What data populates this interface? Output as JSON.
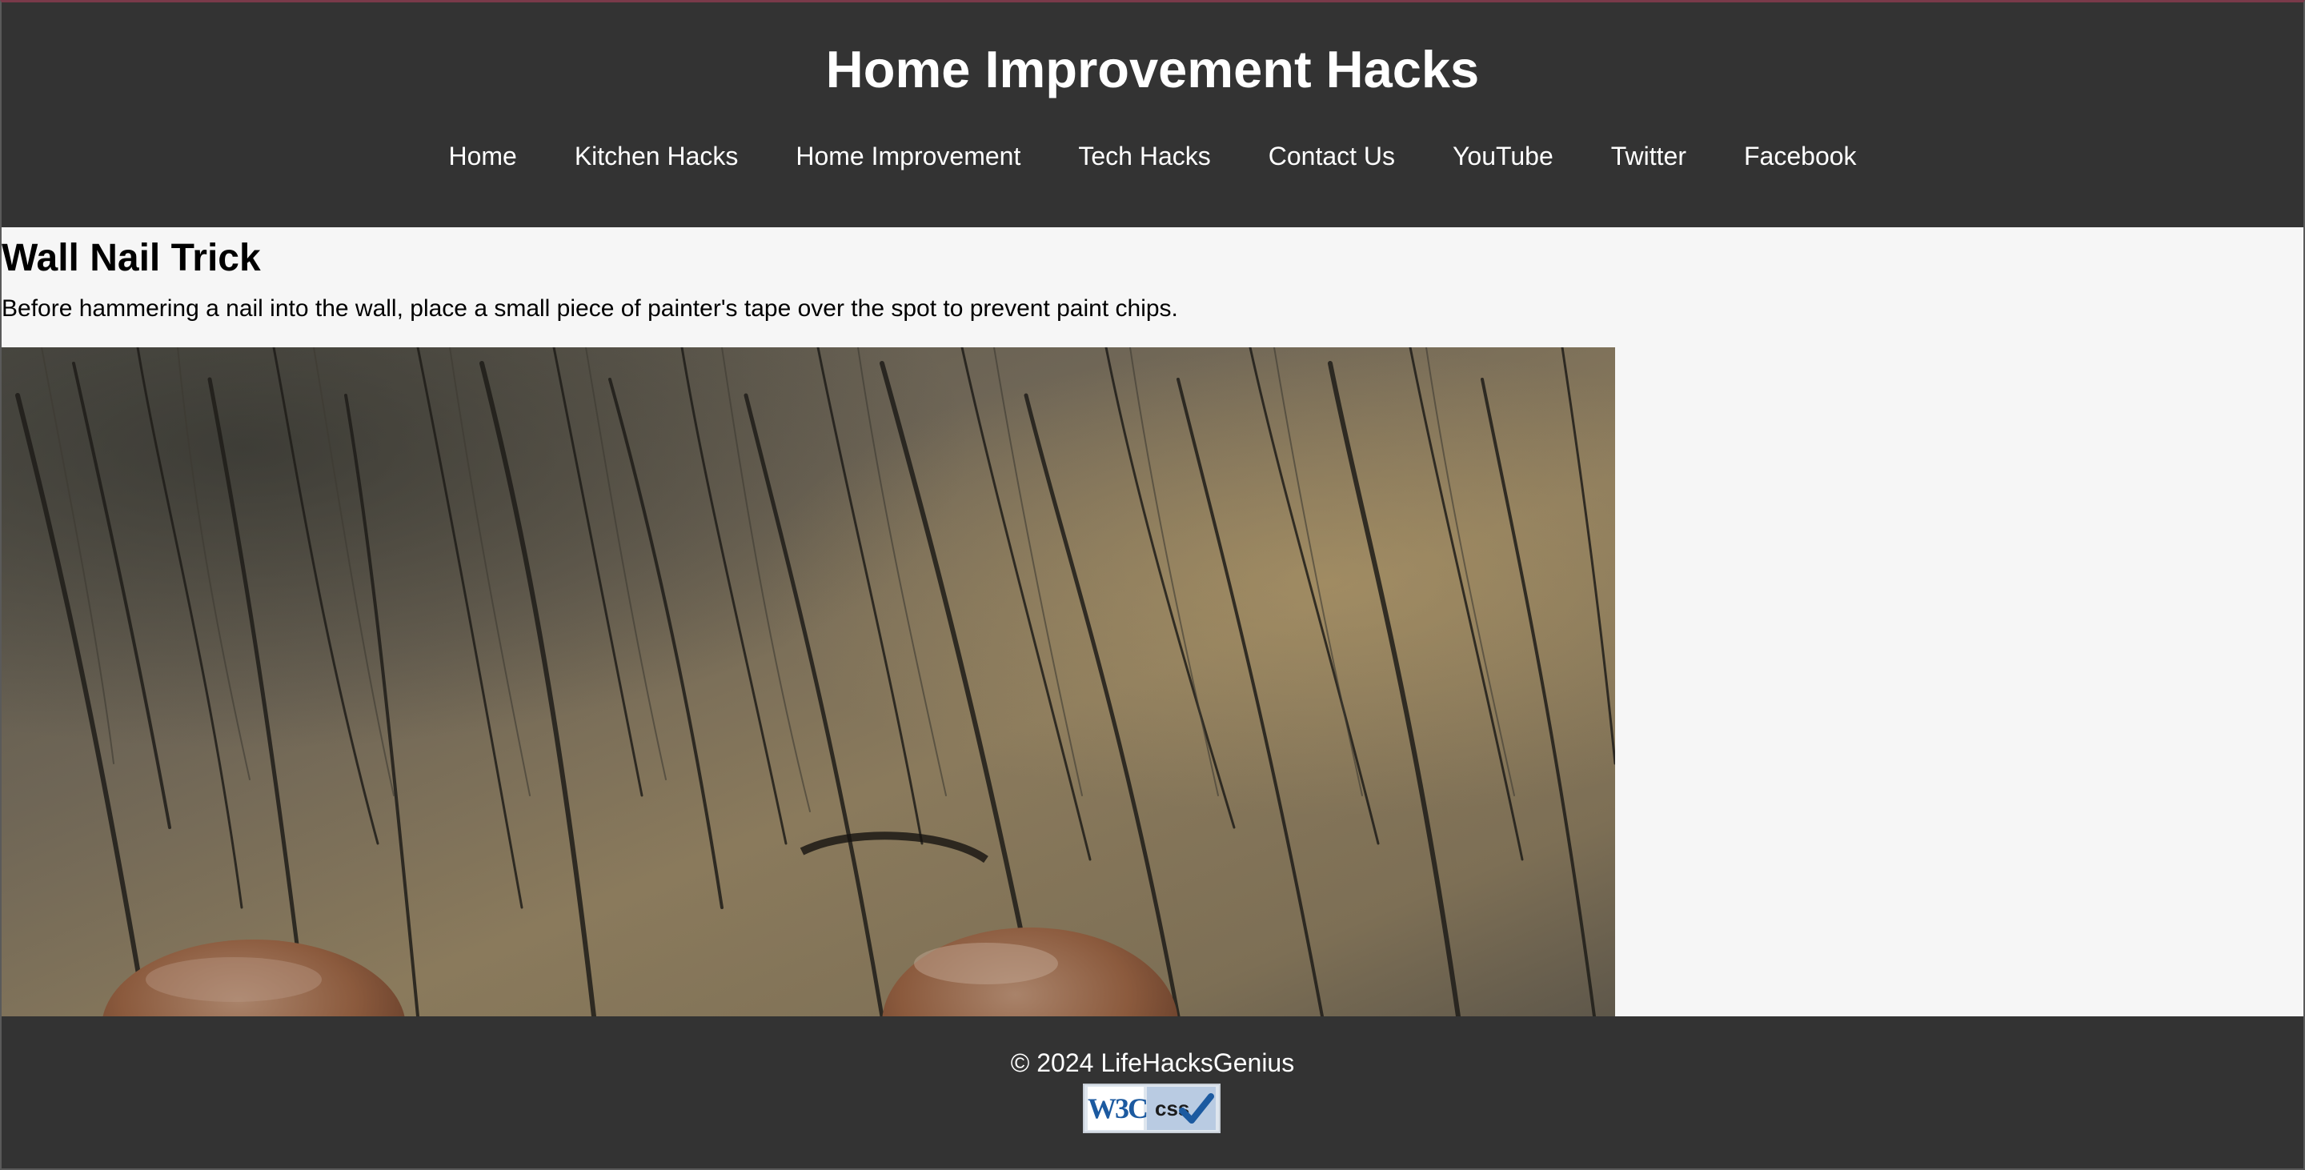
{
  "header": {
    "title": "Home Improvement Hacks",
    "nav": [
      {
        "label": "Home"
      },
      {
        "label": "Kitchen Hacks"
      },
      {
        "label": "Home Improvement"
      },
      {
        "label": "Tech Hacks"
      },
      {
        "label": "Contact Us"
      },
      {
        "label": "YouTube"
      },
      {
        "label": "Twitter"
      },
      {
        "label": "Facebook"
      }
    ]
  },
  "article": {
    "title": "Wall Nail Trick",
    "text": "Before hammering a nail into the wall, place a small piece of painter's tape over the spot to prevent paint chips.",
    "image_subject": "weathered-wood-with-rusty-nail-heads"
  },
  "footer": {
    "copyright": "© 2024 LifeHacksGenius",
    "badge": {
      "logo_text": "W3C",
      "label": "css",
      "icon": "check-icon"
    }
  },
  "colors": {
    "header_bg": "#333333",
    "footer_bg": "#333333",
    "page_bg": "#f6f6f6",
    "text_light": "#ffffff",
    "text_dark": "#000000",
    "badge_blue": "#1c5aa0"
  }
}
